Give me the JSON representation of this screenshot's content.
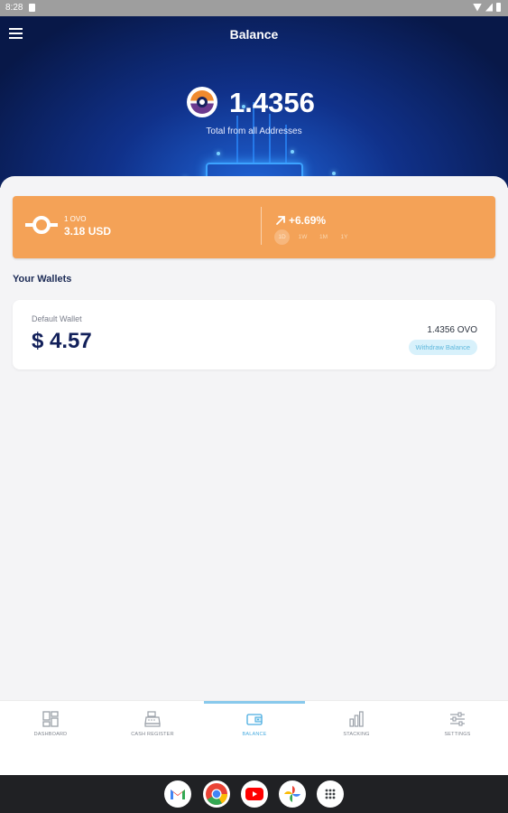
{
  "status_bar": {
    "time": "8:28"
  },
  "header": {
    "title": "Balance",
    "menu_icon": "hamburger-menu-icon"
  },
  "balance": {
    "amount": "1.4356",
    "caption": "Total from all Addresses",
    "coin_icon": "ovo-coin-logo"
  },
  "price_card": {
    "unit": "1 OVO",
    "usd": "3.18 USD",
    "change": "+6.69%",
    "change_icon": "trend-up-arrow-icon",
    "periods": [
      "1D",
      "1W",
      "1M",
      "1Y"
    ],
    "selected_period": "1D",
    "background_color": "#f4a257"
  },
  "wallets": {
    "heading": "Your Wallets",
    "items": [
      {
        "name": "Default Wallet",
        "usd_value": "$ 4.57",
        "ovo_value": "1.4356 OVO",
        "action": "Withdraw Balance"
      }
    ]
  },
  "bottom_nav": {
    "tabs": [
      {
        "label": "DASHBOARD",
        "icon": "dashboard-icon"
      },
      {
        "label": "CASH REGISTER",
        "icon": "cash-register-icon"
      },
      {
        "label": "BALANCE",
        "icon": "wallet-icon"
      },
      {
        "label": "STACKING",
        "icon": "bar-chart-icon"
      },
      {
        "label": "SETTINGS",
        "icon": "sliders-icon"
      }
    ],
    "active": "BALANCE",
    "active_color": "#49ace0"
  },
  "dock": {
    "apps": [
      "gmail-icon",
      "chrome-icon",
      "youtube-icon",
      "photos-icon",
      "app-drawer-icon"
    ]
  }
}
